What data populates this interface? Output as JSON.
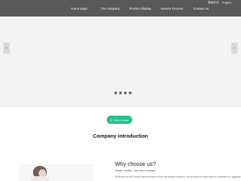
{
  "header": {
    "languages": [
      "简体中文",
      "English"
    ],
    "nav": [
      "Home page",
      "The company",
      "Product display",
      "Service Process",
      "Contact us"
    ]
  },
  "banner": {
    "prev_icon": "chevron-left-icon",
    "next_icon": "chevron-right-icon",
    "dots_count": 4
  },
  "cta": {
    "label": "☰ Click to view"
  },
  "company": {
    "title": "Company introduction"
  },
  "why": {
    "title": "Why choose us?",
    "subtitle": "Shean Global - non-food concept",
    "text": "Business is the home improvement of the necessary experts, the product is essential to complete or upgrade"
  }
}
